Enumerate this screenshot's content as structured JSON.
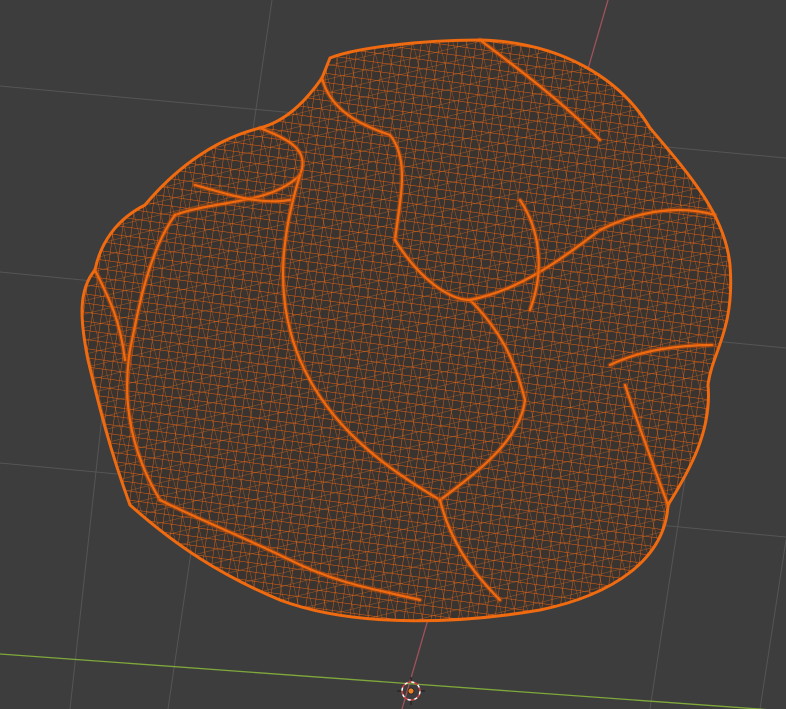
{
  "viewport": {
    "background_color": "#3d3d3d",
    "grid_color": "#555555",
    "x_axis_color": "#7fa83b",
    "y_axis_color": "#a0525b",
    "selected_wire_color": "#f06a10",
    "selected_wire_dark_color": "#c24e0a",
    "origin_icon": "3d-cursor-icon"
  }
}
